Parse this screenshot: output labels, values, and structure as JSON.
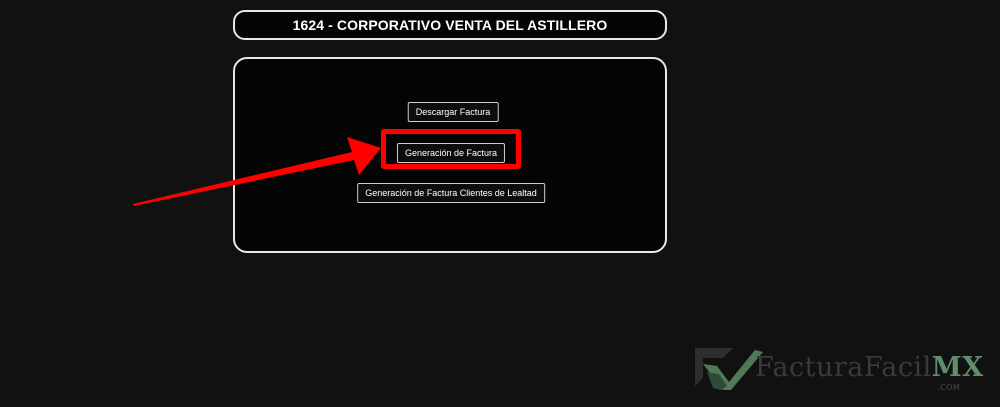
{
  "header": {
    "title": "1624 - CORPORATIVO VENTA DEL ASTILLERO"
  },
  "panel": {
    "buttons": {
      "descargar": "Descargar Factura",
      "generacion": "Generación de Factura",
      "lealtad": "Generación de Factura Clientes de Lealtad"
    }
  },
  "annotation": {
    "color": "#ff0000"
  },
  "watermark": {
    "brand_main": "FacturaFacil",
    "brand_accent": "MX",
    "domain": ".COM",
    "accent_color": "#5f8f6a"
  }
}
